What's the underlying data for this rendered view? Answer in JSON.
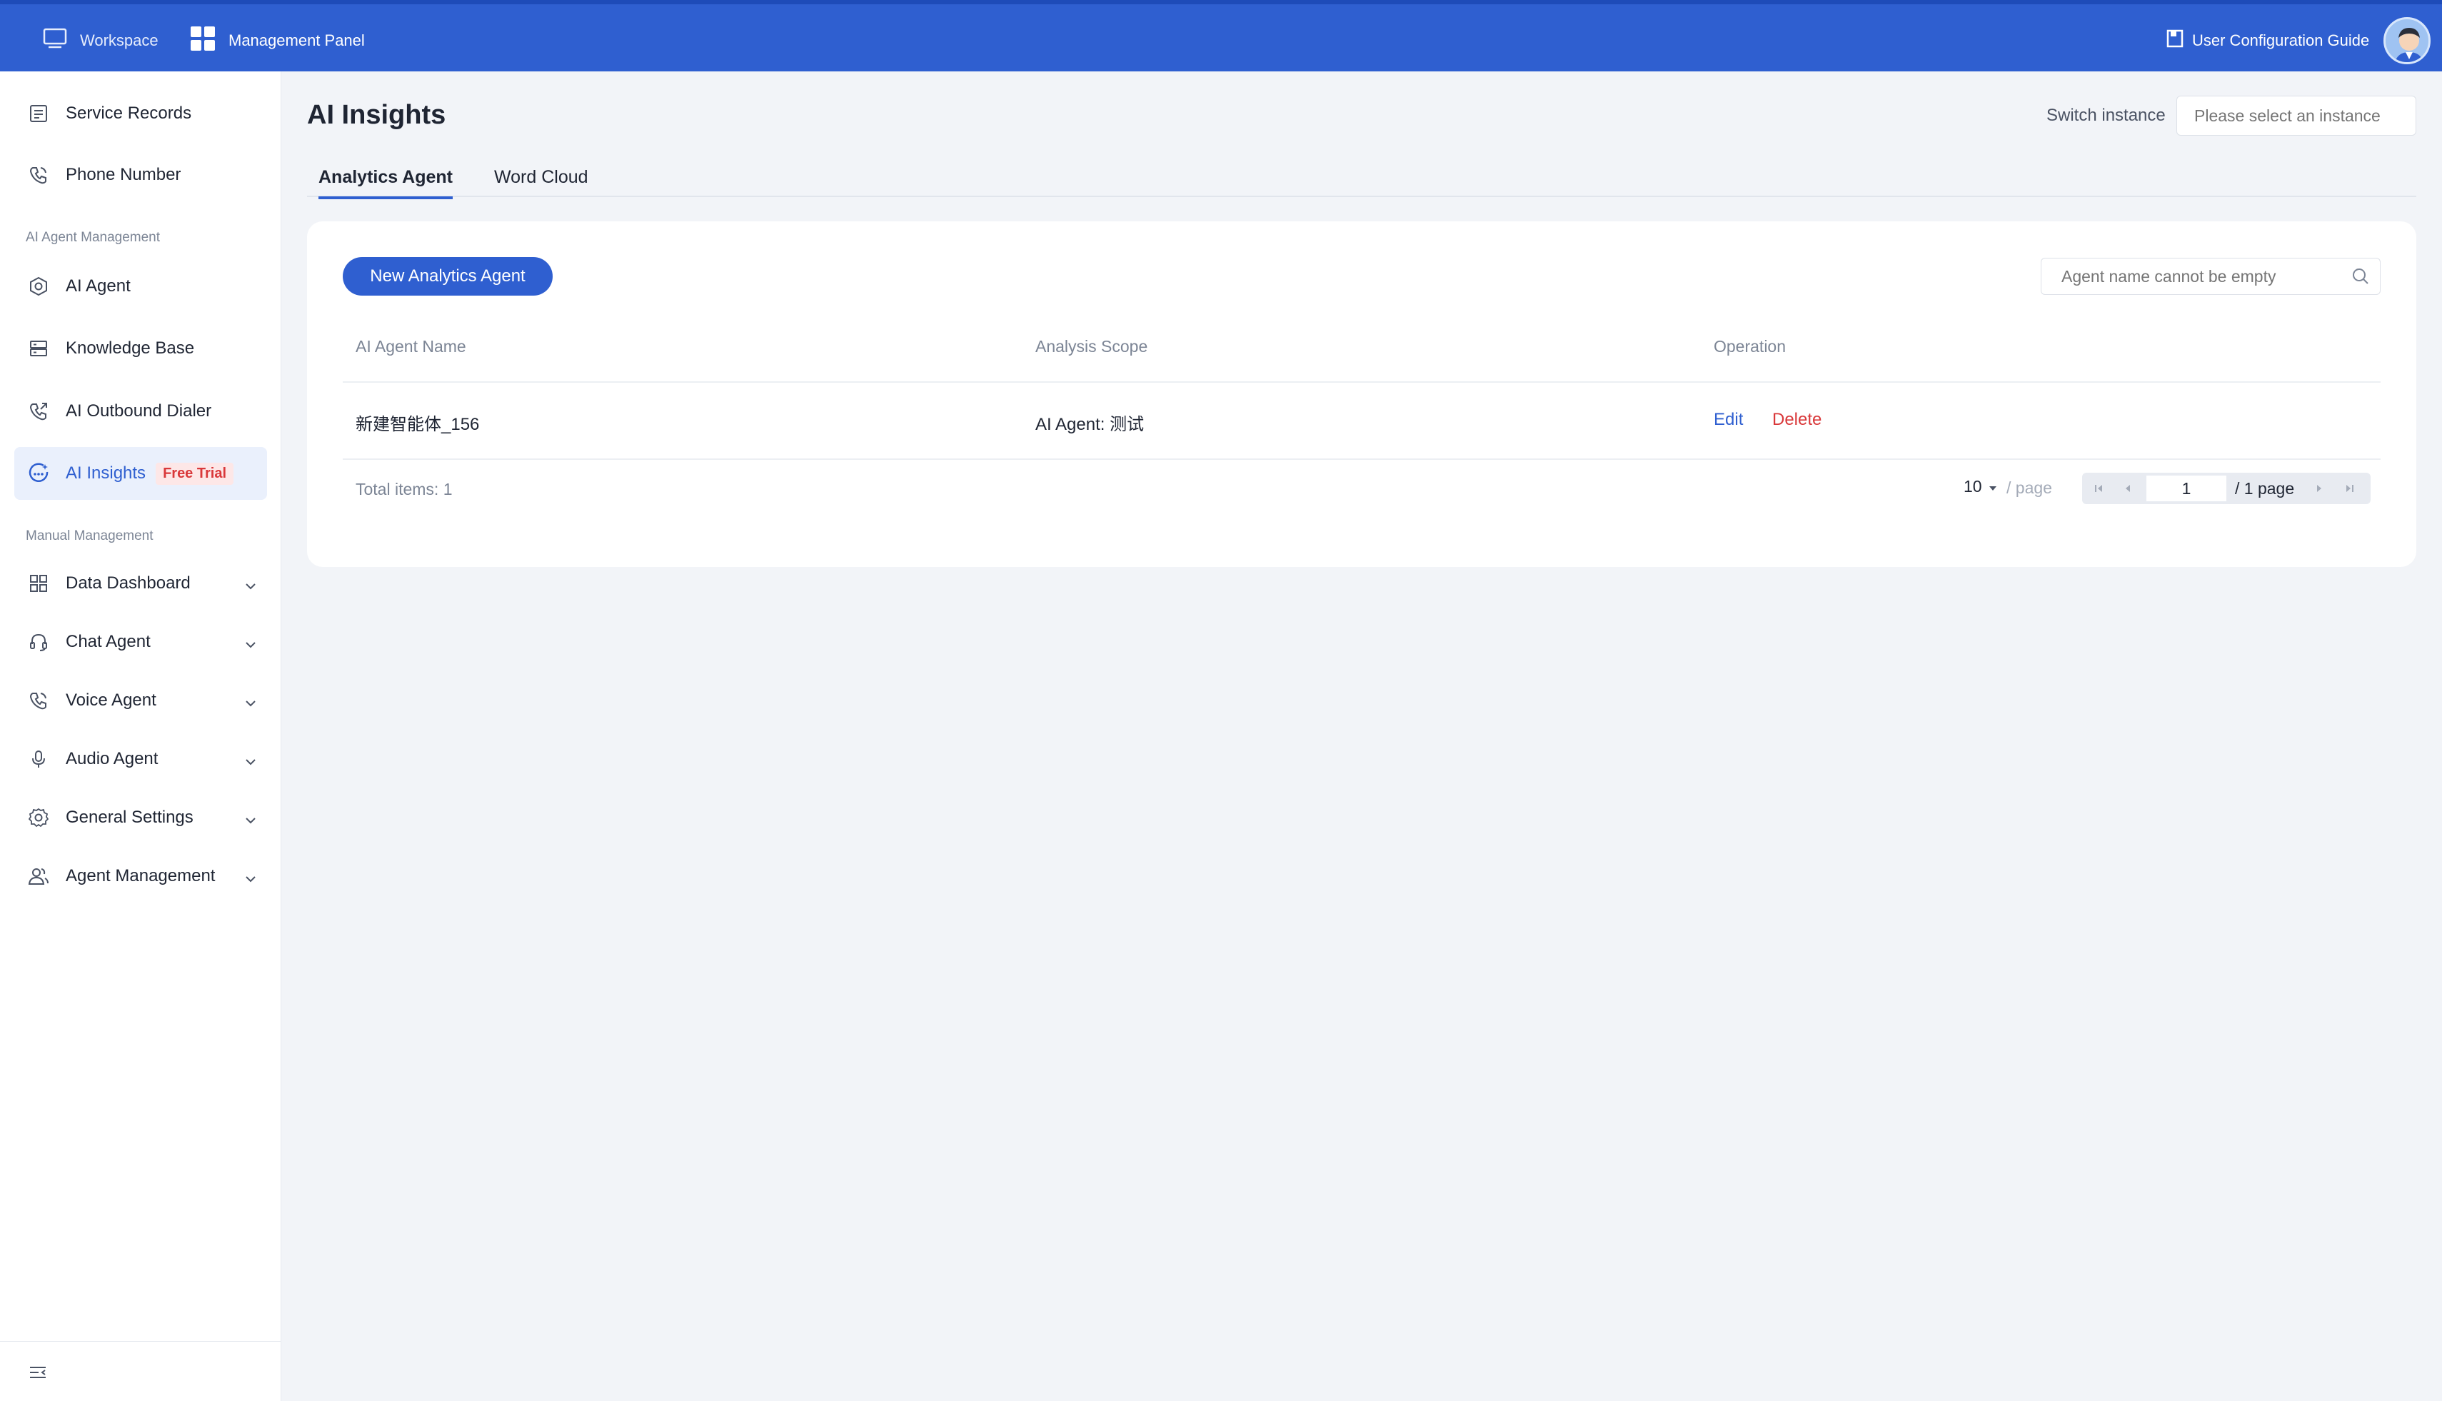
{
  "topbar": {
    "workspace": "Workspace",
    "management_panel": "Management Panel",
    "config_guide": "User Configuration Guide"
  },
  "sidebar": {
    "service_records": "Service Records",
    "phone_number": "Phone Number",
    "section_ai": "AI Agent Management",
    "ai_agent": "AI Agent",
    "knowledge_base": "Knowledge Base",
    "outbound_dialer": "AI Outbound Dialer",
    "ai_insights": "AI Insights",
    "free_trial": "Free Trial",
    "section_manual": "Manual Management",
    "data_dashboard": "Data Dashboard",
    "chat_agent": "Chat Agent",
    "voice_agent": "Voice Agent",
    "audio_agent": "Audio Agent",
    "general_settings": "General Settings",
    "agent_management": "Agent Management"
  },
  "main": {
    "title": "AI Insights",
    "switch_label": "Switch instance",
    "instance_placeholder": "Please select an instance",
    "tabs": [
      "Analytics Agent",
      "Word Cloud"
    ],
    "new_button": "New Analytics Agent",
    "search_placeholder": "Agent name cannot be empty"
  },
  "table": {
    "columns": [
      "AI Agent Name",
      "Analysis Scope",
      "Operation"
    ],
    "rows": [
      {
        "name": "新建智能体_156",
        "scope": "AI Agent: 测试",
        "edit": "Edit",
        "delete": "Delete"
      }
    ],
    "total": "Total items: 1"
  },
  "pagination": {
    "page_size": "10",
    "per_page": "/ page",
    "current": "1",
    "total_pages": "/ 1 page"
  },
  "colors": {
    "primary": "#2f5fd0",
    "danger": "#d9383a"
  }
}
